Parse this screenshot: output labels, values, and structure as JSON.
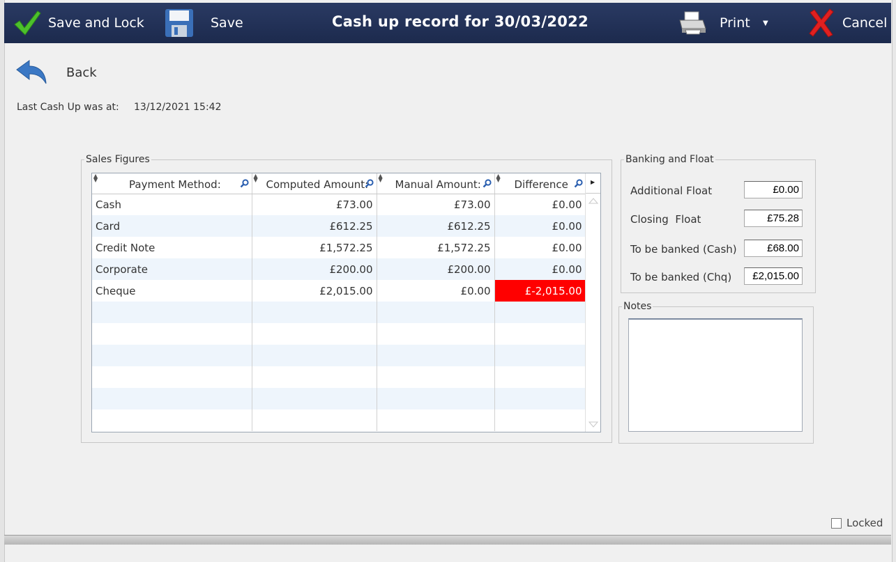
{
  "toolbar": {
    "save_lock_label": "Save and Lock",
    "save_label": "Save",
    "title": "Cash up record for 30/03/2022",
    "print_label": "Print",
    "cancel_label": "Cancel"
  },
  "back_label": "Back",
  "last_cashup": {
    "label": "Last Cash Up was at:",
    "value": "13/12/2021 15:42"
  },
  "sales": {
    "legend": "Sales Figures",
    "columns": [
      "Payment Method:",
      "Computed Amount:",
      "Manual Amount:",
      "Difference"
    ],
    "rows": [
      [
        "Cash",
        "£73.00",
        "£73.00",
        "£0.00"
      ],
      [
        "Card",
        "£612.25",
        "£612.25",
        "£0.00"
      ],
      [
        "Credit Note",
        "£1,572.25",
        "£1,572.25",
        "£0.00"
      ],
      [
        "Corporate",
        "£200.00",
        "£200.00",
        "£0.00"
      ],
      [
        "Cheque",
        "£2,015.00",
        "£0.00",
        "£-2,015.00"
      ]
    ],
    "highlight_color": "#ff0000"
  },
  "banking": {
    "legend": "Banking and Float",
    "additional_float": {
      "label": "Additional Float",
      "value": "£0.00"
    },
    "closing_float": {
      "label": "Closing  Float",
      "value": "£75.28"
    },
    "banked_cash": {
      "label": "To be banked (Cash)",
      "value": "£68.00"
    },
    "banked_chq": {
      "label": "To be banked (Chq)",
      "value": "£2,015.00"
    }
  },
  "notes": {
    "legend": "Notes",
    "value": ""
  },
  "locked": {
    "label": "Locked",
    "checked": false
  },
  "colors": {
    "toolbar_bg": "#1f2d52",
    "row_alt": "#eef5fc"
  }
}
